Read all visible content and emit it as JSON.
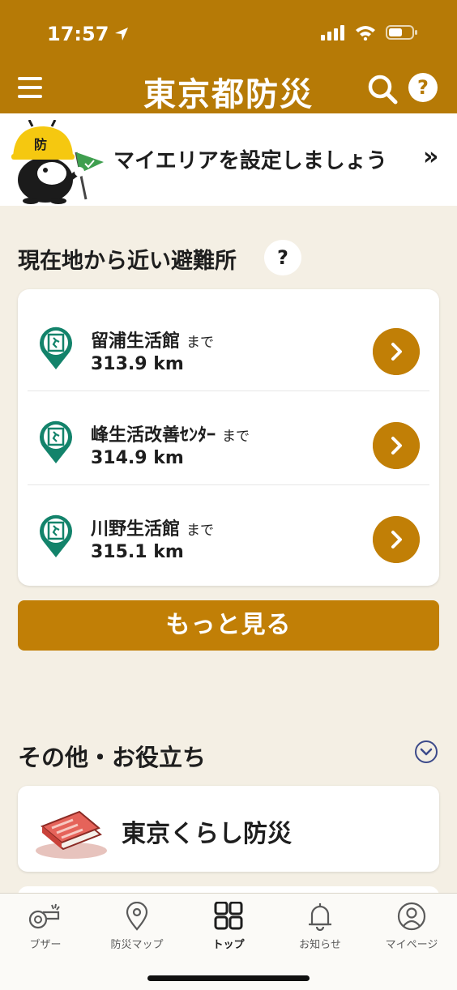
{
  "status_bar": {
    "time": "17:57"
  },
  "header": {
    "title": "東京都防災",
    "help_label": "?"
  },
  "myarea_banner": {
    "text": "マイエリアを設定しましょう",
    "chevron": "»",
    "mascot_badge": "防"
  },
  "nearby": {
    "title": "現在地から近い避難所",
    "help_label": "?",
    "suffix": "まで",
    "shelters": [
      {
        "name": "留浦生活館",
        "distance": "313.9 km"
      },
      {
        "name": "峰生活改善ｾﾝﾀｰ",
        "distance": "314.9 km"
      },
      {
        "name": "川野生活館",
        "distance": "315.1 km"
      }
    ],
    "more_label": "もっと見る"
  },
  "other": {
    "title": "その他・お役立ち",
    "items": [
      {
        "label": "東京くらし防災"
      }
    ]
  },
  "tabbar": {
    "items": [
      {
        "label": "ブザー",
        "icon": "whistle-icon"
      },
      {
        "label": "防災マップ",
        "icon": "map-pin-icon"
      },
      {
        "label": "トップ",
        "icon": "grid-icon",
        "active": true
      },
      {
        "label": "お知らせ",
        "icon": "bell-icon"
      },
      {
        "label": "マイページ",
        "icon": "person-icon"
      }
    ]
  },
  "colors": {
    "brand": "#b67a06",
    "button": "#c17f06",
    "background": "#f4efe4",
    "shelter_green": "#13836b"
  }
}
